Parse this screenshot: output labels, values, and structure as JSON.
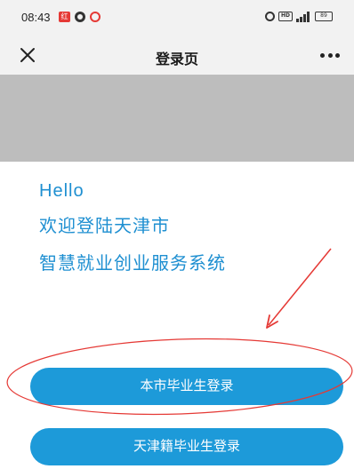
{
  "status_bar": {
    "time": "08:43",
    "red_notification_label": "红",
    "hd_label": "HD",
    "battery_label": "89",
    "icons": [
      "red-app-icon",
      "dark-app-icon",
      "pink-app-icon",
      "alarm-icon",
      "hd-icon",
      "signal-icon",
      "battery-icon"
    ]
  },
  "nav": {
    "close_icon": "close-icon",
    "title": "登录页",
    "more_icon": "more-icon"
  },
  "greeting": {
    "hello": "Hello",
    "line1": "欢迎登陆天津市",
    "line2": "智慧就业创业服务系统"
  },
  "buttons": {
    "local_graduate": "本市毕业生登录",
    "tianjin_graduate": "天津籍毕业生登录"
  },
  "colors": {
    "accent": "#1d9ad9",
    "greeting_text": "#1e8fd1",
    "annotation": "#e53935",
    "banner": "#bdbdbd",
    "nav_background": "#f2f2f2"
  }
}
